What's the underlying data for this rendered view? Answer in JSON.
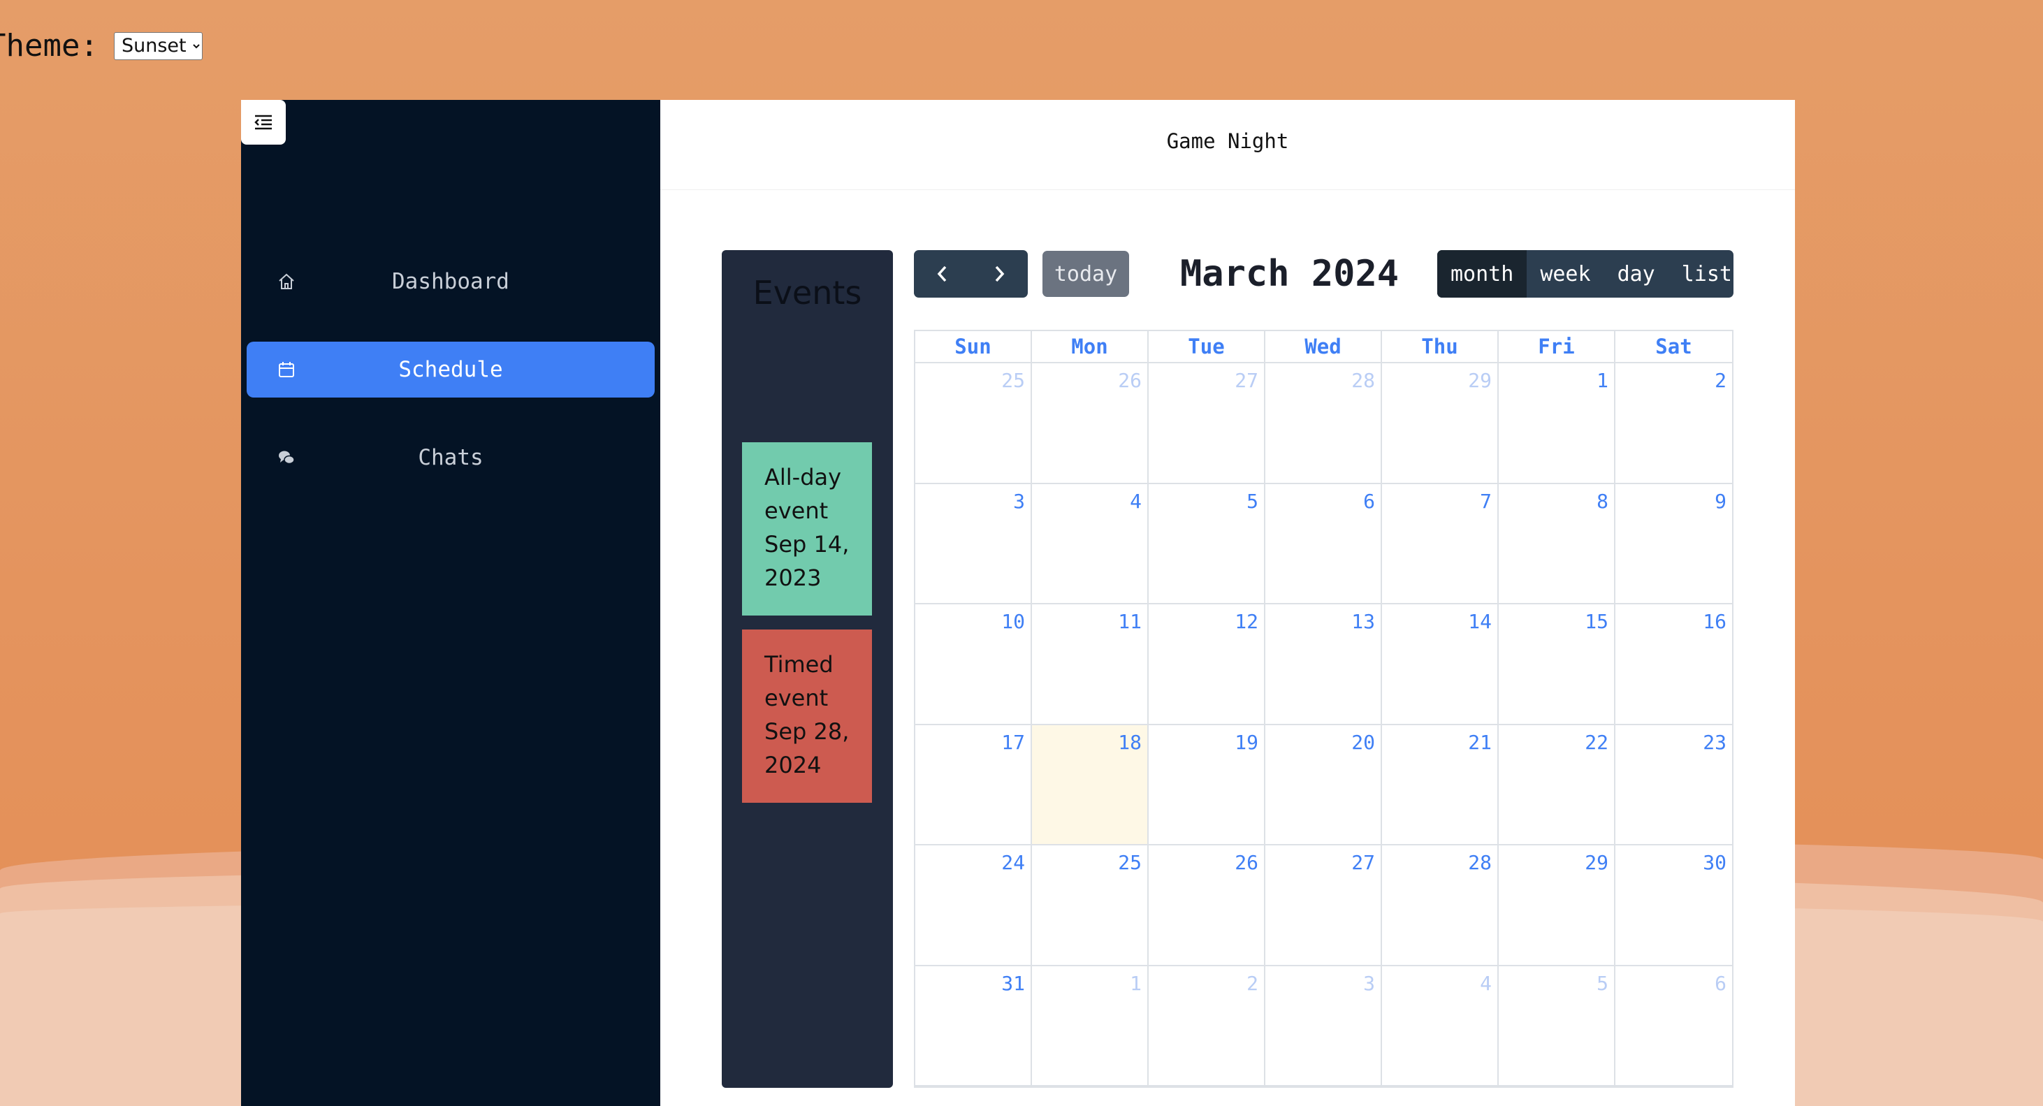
{
  "theme": {
    "label": "Theme:",
    "selected": "Sunset"
  },
  "sidebar": {
    "items": [
      {
        "label": "Dashboard",
        "icon": "home-icon"
      },
      {
        "label": "Schedule",
        "icon": "calendar-icon"
      },
      {
        "label": "Chats",
        "icon": "chat-icon"
      }
    ],
    "active": "Schedule"
  },
  "header": {
    "title": "Game Night"
  },
  "events_panel": {
    "title": "Events",
    "cards": [
      {
        "title": "All-day event",
        "date": "Sep 14, 2023",
        "color": "#72cbad"
      },
      {
        "title": "Timed event",
        "date": "Sep 28, 2024",
        "color": "#cd5b50"
      }
    ]
  },
  "calendar": {
    "title": "March 2024",
    "today_label": "today",
    "views": [
      "month",
      "week",
      "day",
      "list"
    ],
    "active_view": "month",
    "weekdays": [
      "Sun",
      "Mon",
      "Tue",
      "Wed",
      "Thu",
      "Fri",
      "Sat"
    ],
    "today": 18,
    "weeks": [
      [
        "25",
        "26",
        "27",
        "28",
        "29",
        "1",
        "2"
      ],
      [
        "3",
        "4",
        "5",
        "6",
        "7",
        "8",
        "9"
      ],
      [
        "10",
        "11",
        "12",
        "13",
        "14",
        "15",
        "16"
      ],
      [
        "17",
        "18",
        "19",
        "20",
        "21",
        "22",
        "23"
      ],
      [
        "24",
        "25",
        "26",
        "27",
        "28",
        "29",
        "30"
      ],
      [
        "31",
        "1",
        "2",
        "3",
        "4",
        "5",
        "6"
      ]
    ]
  },
  "colors": {
    "accent": "#3f7ff5",
    "sidebar_bg": "#041325",
    "toolbar_bg": "#2c3e50",
    "today_bg": "#fef8e6"
  }
}
